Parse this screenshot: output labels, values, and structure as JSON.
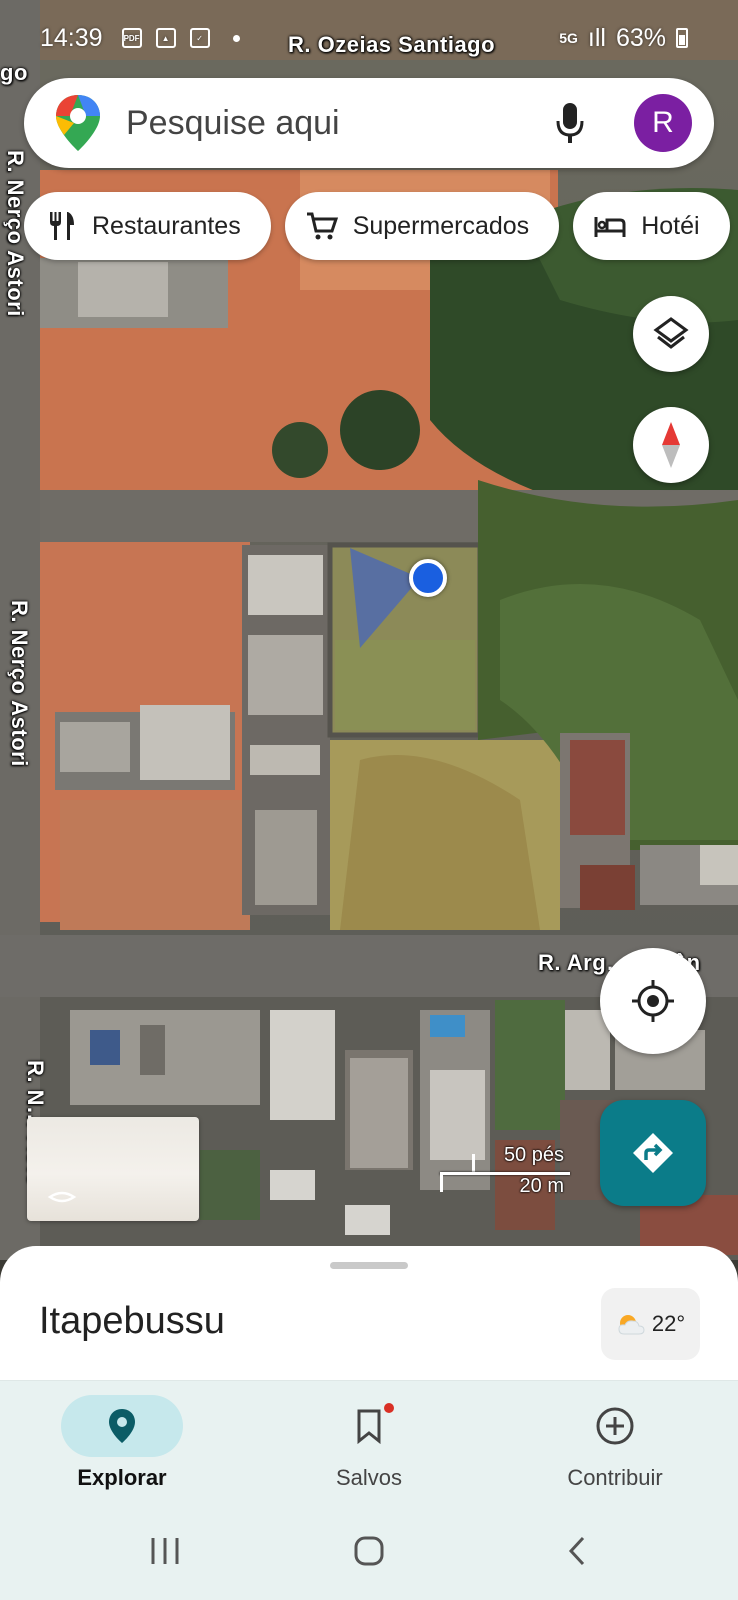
{
  "status_bar": {
    "time": "14:39",
    "battery": "63%",
    "network": "5G"
  },
  "map": {
    "road_labels": {
      "top": "R. Ozeias Santiago",
      "left_top": "R. Nerço Astori",
      "left_mid": "R. Nerço Astori",
      "left_bottom": "R. N… Ásto",
      "corner": "go",
      "lower_horizontal": "R. Arg… Antôn"
    },
    "scale": {
      "imperial": "50 pés",
      "metric": "20 m"
    }
  },
  "search": {
    "placeholder": "Pesquise aqui",
    "avatar_letter": "R"
  },
  "chips": [
    {
      "label": "Restaurantes",
      "icon": "fork-knife-icon"
    },
    {
      "label": "Supermercados",
      "icon": "cart-icon"
    },
    {
      "label": "Hotéi",
      "icon": "bed-icon"
    }
  ],
  "sheet": {
    "place": "Itapebussu",
    "temperature": "22°",
    "weather_icon": "partly-sunny-icon"
  },
  "nav": {
    "items": [
      {
        "label": "Explorar",
        "icon": "pin-icon",
        "active": true
      },
      {
        "label": "Salvos",
        "icon": "bookmark-icon",
        "active": false
      },
      {
        "label": "Contribuir",
        "icon": "add-circle-icon",
        "active": false
      }
    ]
  },
  "colors": {
    "accent": "#0b7c89",
    "location_dot": "#1a5fe0",
    "avatar": "#7b1fa2",
    "nav_bg": "#e8f2f1"
  }
}
